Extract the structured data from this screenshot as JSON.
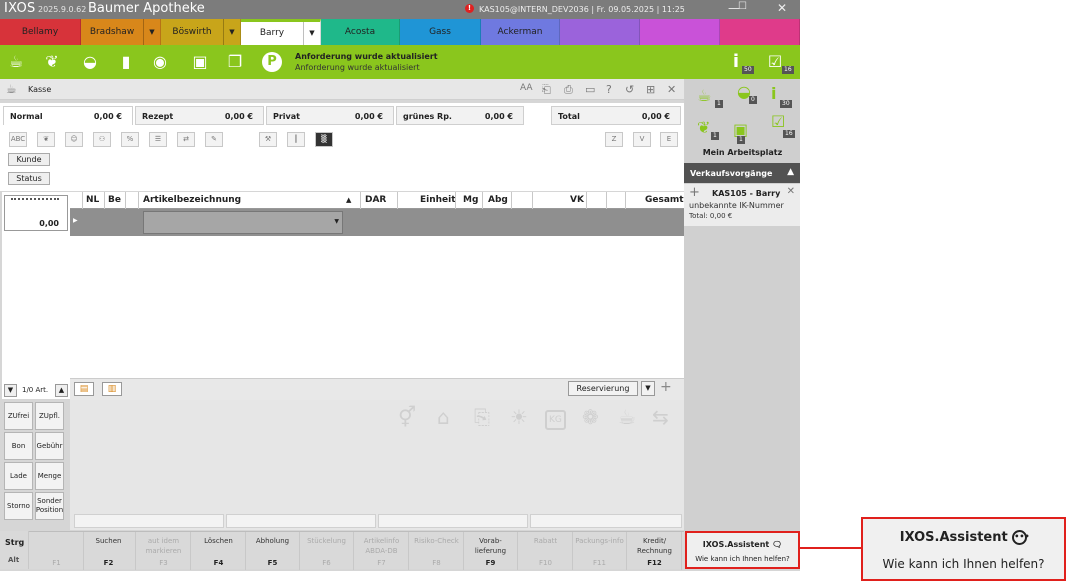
{
  "titlebar": {
    "brand": "IXOS",
    "version": "2025.9.0.62",
    "pharmacy": "Baumer Apotheke",
    "warning": "!",
    "user_info": "KAS105@INTERN_DEV2036 | Fr. 09.05.2025 | 11:25",
    "minimize": "—",
    "maximize": "☐",
    "close": "✕"
  },
  "user_tabs": [
    {
      "name": "Bellamy",
      "color": "#d7333a",
      "dropdown": false
    },
    {
      "name": "Bradshaw",
      "color": "#d8871a",
      "dropdown": true
    },
    {
      "name": "Böswirth",
      "color": "#c8a51a",
      "dropdown": true
    },
    {
      "name": "Barry",
      "color": "#8ac61d",
      "dropdown": true,
      "active": true
    },
    {
      "name": "Acosta",
      "color": "#1fb88a",
      "dropdown": false
    },
    {
      "name": "Gass",
      "color": "#1f95d6",
      "dropdown": false
    },
    {
      "name": "Ackerman",
      "color": "#6f79e0",
      "dropdown": false
    },
    {
      "name": "",
      "color": "#9b63db",
      "dropdown": false
    },
    {
      "name": "",
      "color": "#c952d8",
      "dropdown": false
    },
    {
      "name": "",
      "color": "#df3b8a",
      "dropdown": false
    }
  ],
  "greenbar": {
    "msg_title": "Anforderung wurde aktualisiert",
    "msg_sub": "Anforderung wurde aktualisiert",
    "info_badge": "50",
    "check_badge": "16",
    "icons": [
      "mortar-icon",
      "leaf-icon",
      "bag-icon",
      "bottle-icon",
      "pills-icon",
      "box-icon",
      "copy-icon",
      "p-icon"
    ]
  },
  "kasse": {
    "label": "Kasse"
  },
  "price_tabs": [
    {
      "name": "Normal",
      "value": "0,00 €"
    },
    {
      "name": "Rezept",
      "value": "0,00 €"
    },
    {
      "name": "Privat",
      "value": "0,00 €"
    },
    {
      "name": "grünes Rp.",
      "value": "0,00 €"
    },
    {
      "name": "Total",
      "value": "0,00 €"
    }
  ],
  "buttons": {
    "kunde": "Kunde",
    "status": "Status"
  },
  "grid": {
    "headers": [
      "NL",
      "Be",
      "Artikelbezeichnung",
      "DAR",
      "Einheit",
      "Mg",
      "Abg",
      "VK",
      "Gesamt"
    ]
  },
  "receipt": {
    "value": "0,00"
  },
  "nav": {
    "count": "1/0 Art.",
    "reservierung": "Reservierung"
  },
  "side_buttons": [
    "ZUfrei",
    "ZUpfl.",
    "Bon",
    "Gebühr",
    "Lade",
    "Menge",
    "Storno",
    "Sonder Position"
  ],
  "fkeys": [
    {
      "label": "",
      "key": "F1",
      "enabled": false
    },
    {
      "label": "Suchen",
      "key": "F2",
      "enabled": true
    },
    {
      "label": "aut idem markieren",
      "key": "F3",
      "enabled": false
    },
    {
      "label": "Löschen",
      "key": "F4",
      "enabled": true
    },
    {
      "label": "Abholung",
      "key": "F5",
      "enabled": true
    },
    {
      "label": "Stückelung",
      "key": "F6",
      "enabled": false
    },
    {
      "label": "Artikelinfo ABDA-DB",
      "key": "F7",
      "enabled": false
    },
    {
      "label": "Risiko-Check",
      "key": "F8",
      "enabled": false
    },
    {
      "label": "Vorab-lieferung",
      "key": "F9",
      "enabled": true
    },
    {
      "label": "Rabatt",
      "key": "F10",
      "enabled": false
    },
    {
      "label": "Packungs-info",
      "key": "F11",
      "enabled": false
    },
    {
      "label": "Kredit/ Rechnung",
      "key": "F12",
      "enabled": true
    }
  ],
  "modkeys": {
    "strg": "Strg",
    "alt": "Alt"
  },
  "workplace": {
    "label": "Mein Arbeitsplatz",
    "badges": [
      "1",
      "0",
      "30",
      "1",
      "1",
      "16"
    ]
  },
  "verkauf": {
    "title": "Verkaufsvorgänge",
    "item_title": "KAS105 - Barry",
    "item_sub": "unbekannte IK-Nummer",
    "item_total": "Total: 0,00 €"
  },
  "assistant": {
    "title": "IXOS.Assistent",
    "sub": "Wie kann ich Ihnen helfen?"
  },
  "callout": {
    "title": "IXOS.Assistent",
    "sub": "Wie kann ich Ihnen helfen?"
  }
}
